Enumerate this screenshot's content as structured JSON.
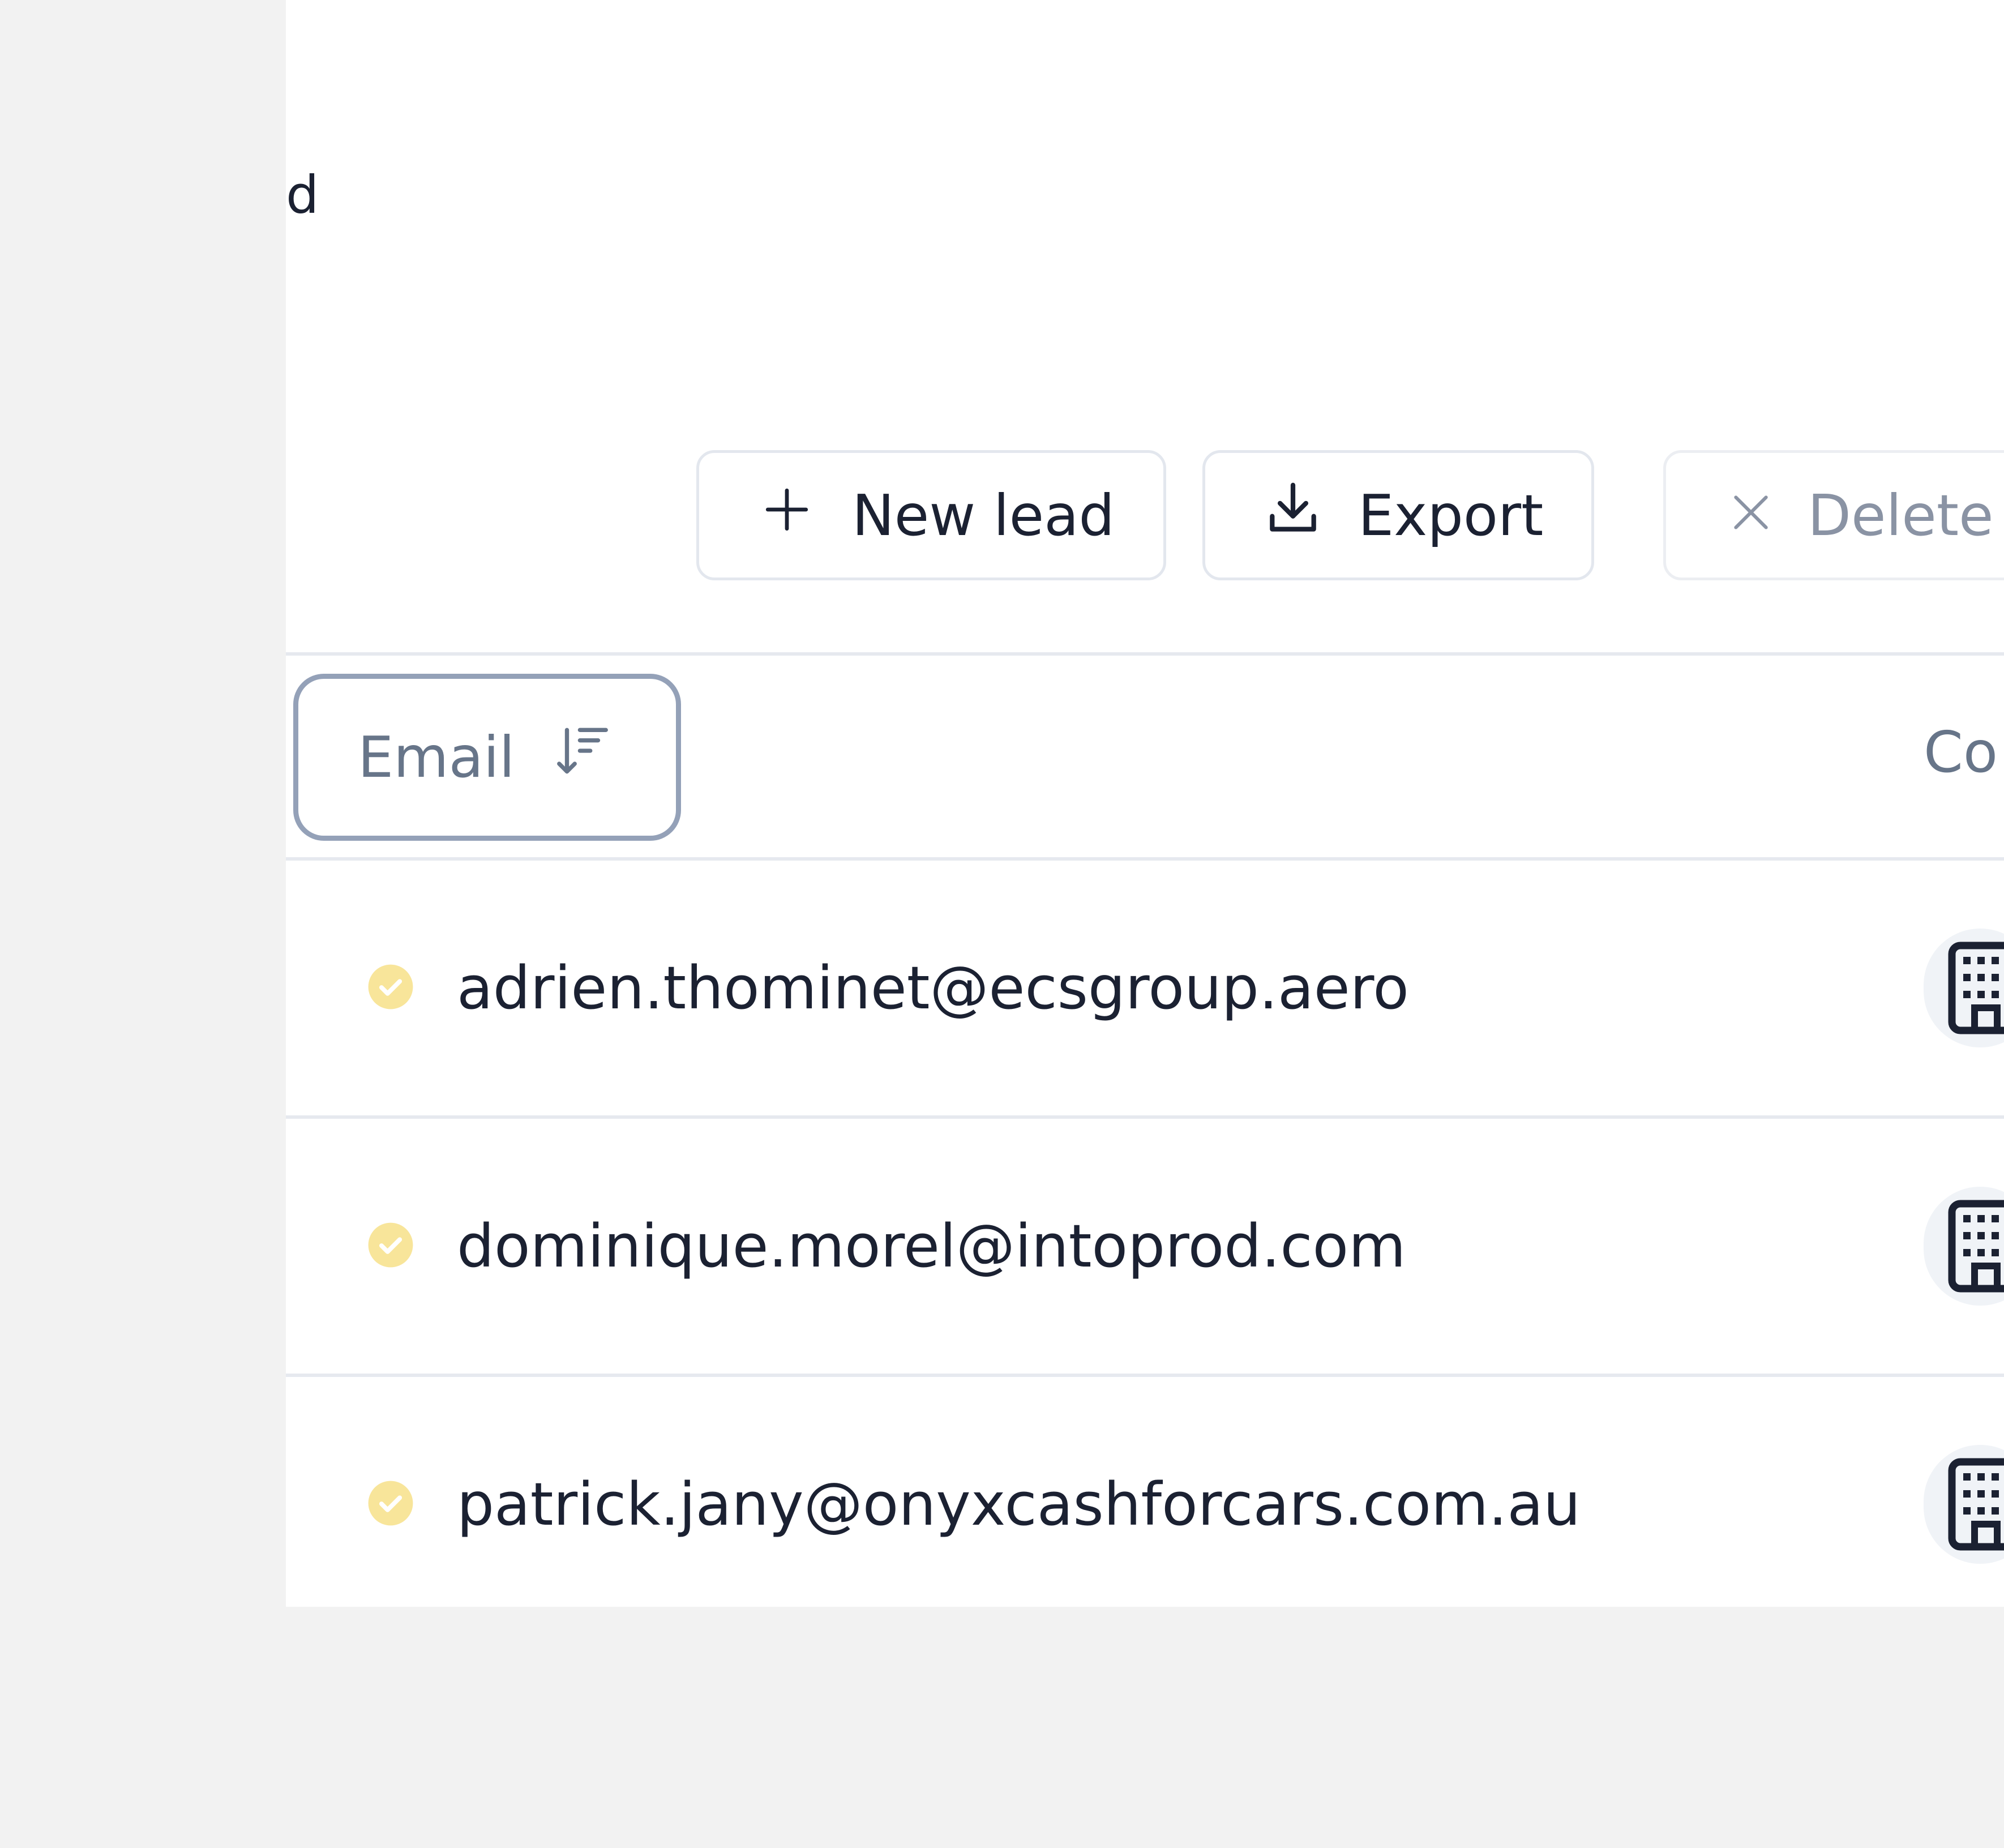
{
  "page": {
    "heading_fragment": "d"
  },
  "toolbar": {
    "new_lead_label": "New lead",
    "export_label": "Export",
    "delete_label": "Delete"
  },
  "table": {
    "columns": [
      {
        "label": "Email",
        "sort": "descending"
      },
      {
        "label": "Co"
      }
    ],
    "rows": [
      {
        "email": "adrien.thominet@ecsgroup.aero",
        "status": "verified",
        "company_icon": "building-icon"
      },
      {
        "email": "dominique.morel@intoprod.com",
        "status": "verified",
        "company_icon": "building-icon"
      },
      {
        "email": "patrick.jany@onyxcashforcars.com.au",
        "status": "verified",
        "company_icon": "building-icon"
      }
    ]
  },
  "icons": {
    "new_lead": "plus-icon",
    "export": "download-icon",
    "delete": "close-icon",
    "sort": "sort-descending-icon",
    "status": "check-circle-icon",
    "company": "building-icon"
  },
  "colors": {
    "status_verified": "#f8e59a",
    "status_check": "#ffffff",
    "text_primary": "#1b2132",
    "text_muted": "#677589",
    "sort_header_border": "#94a1b8"
  }
}
